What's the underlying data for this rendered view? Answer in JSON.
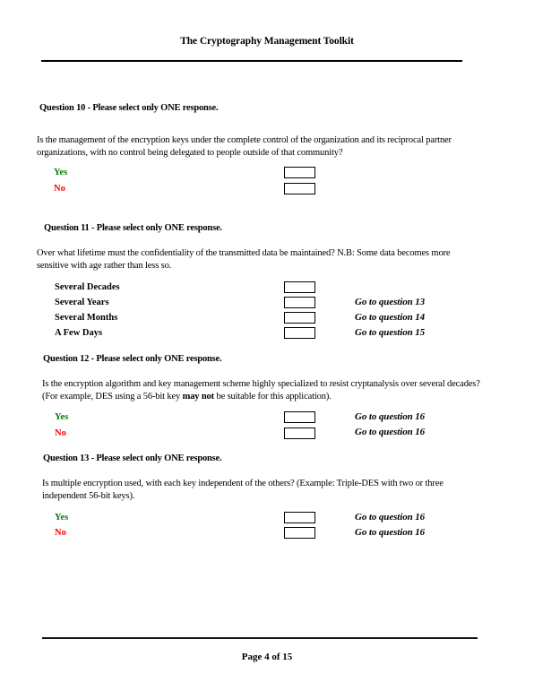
{
  "header": {
    "title": "The Cryptography Management Toolkit"
  },
  "footer": {
    "page_label": "Page 4 of 15",
    "current_page": 4,
    "total_pages": 15
  },
  "questions": [
    {
      "heading": "Question 10 - Please select only ONE response.",
      "text": "Is the management of the encryption keys under the complete control of the organization and its reciprocal partner organizations, with no control being delegated to people outside of that community?",
      "options": [
        {
          "label": "Yes",
          "color": "#008000",
          "goto": ""
        },
        {
          "label": "No",
          "color": "#ff0000",
          "goto": ""
        }
      ]
    },
    {
      "heading": "Question 11 - Please select only ONE response.",
      "text": "Over what lifetime must the confidentiality of the transmitted data be maintained?  N.B: Some data becomes more sensitive with age rather than less so.",
      "options": [
        {
          "label": "Several Decades",
          "color": "#000000",
          "goto": ""
        },
        {
          "label": "Several Years",
          "color": "#000000",
          "goto": "Go to question 13"
        },
        {
          "label": "Several Months",
          "color": "#000000",
          "goto": "Go to question 14"
        },
        {
          "label": "A Few Days",
          "color": "#000000",
          "goto": "Go to question 15"
        }
      ]
    },
    {
      "heading": "Question 12 - Please select only ONE response.",
      "text_before": "Is the encryption algorithm and key management scheme highly specialized to resist cryptanalysis over several decades?  (For example, DES using a 56-bit key ",
      "text_bold": "may not",
      "text_after": " be suitable for this application).",
      "options": [
        {
          "label": "Yes",
          "color": "#008000",
          "goto": "Go to question 16"
        },
        {
          "label": "No",
          "color": "#ff0000",
          "goto": "Go to question 16"
        }
      ]
    },
    {
      "heading": "Question 13 - Please select only ONE response.",
      "text": "Is multiple encryption used, with each key independent of the others?  (Example: Triple-DES with two or three independent 56-bit keys).",
      "options": [
        {
          "label": "Yes",
          "color": "#008000",
          "goto": "Go to question 16"
        },
        {
          "label": "No",
          "color": "#ff0000",
          "goto": "Go to question 16"
        }
      ]
    }
  ]
}
